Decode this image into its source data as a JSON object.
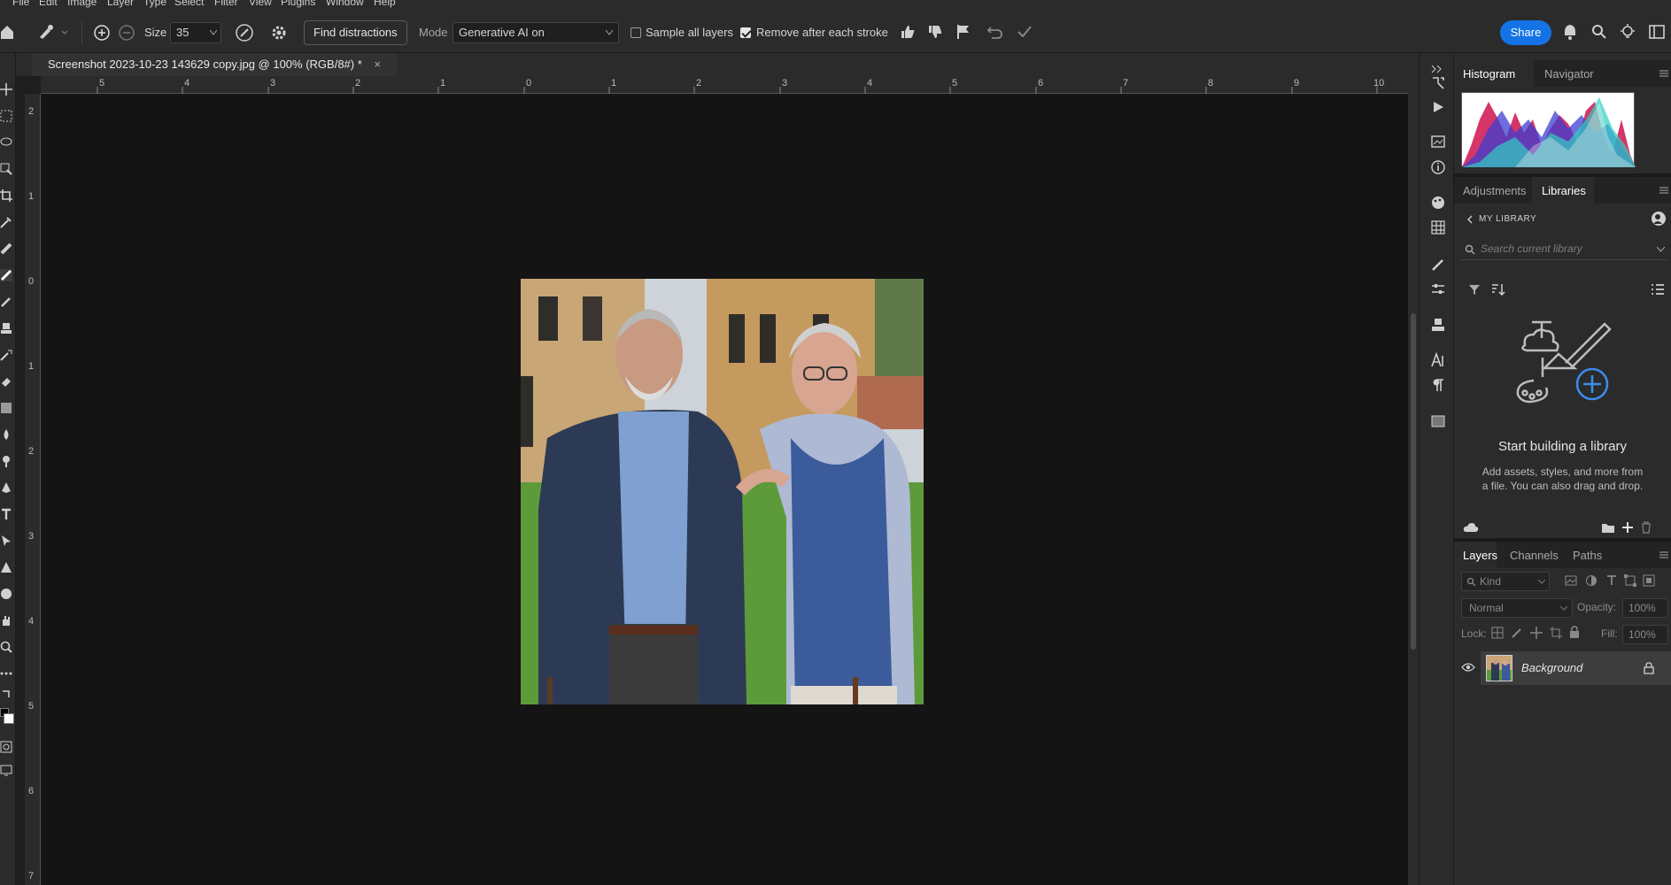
{
  "menu": [
    "File",
    "Edit",
    "Image",
    "Layer",
    "Type",
    "Select",
    "Filter",
    "View",
    "Plugins",
    "Window",
    "Help"
  ],
  "options": {
    "size_label": "Size",
    "size_value": "35",
    "find_distractions": "Find distractions",
    "mode_label": "Mode",
    "mode_value": "Generative AI on",
    "sample_all_layers": "Sample all layers",
    "sample_all_layers_checked": false,
    "remove_after_stroke": "Remove after each stroke",
    "remove_after_stroke_checked": true,
    "share": "Share"
  },
  "document": {
    "tab_title": "Screenshot 2023-10-23 143629 copy.jpg @ 100% (RGB/8#) *"
  },
  "rulers": {
    "h_labels": [
      "5",
      "4",
      "3",
      "2",
      "1",
      "0",
      "1",
      "2",
      "3",
      "4",
      "5",
      "6",
      "7",
      "8",
      "9",
      "10"
    ],
    "v_labels": [
      "2",
      "1",
      "0",
      "1",
      "2",
      "3",
      "4",
      "5",
      "6",
      "7"
    ]
  },
  "histogram_panel": {
    "tabs": [
      "Histogram",
      "Navigator"
    ],
    "active": "Histogram"
  },
  "libraries_panel": {
    "tabs": [
      "Adjustments",
      "Libraries"
    ],
    "active": "Libraries",
    "breadcrumb": "MY LIBRARY",
    "search_placeholder": "Search current library",
    "empty_title": "Start building a library",
    "empty_desc_line1": "Add assets, styles, and more from",
    "empty_desc_line2": "a file. You can also drag and drop."
  },
  "layers_panel": {
    "tabs": [
      "Layers",
      "Channels",
      "Paths"
    ],
    "active": "Layers",
    "kind_label": "Kind",
    "blend_mode": "Normal",
    "opacity_label": "Opacity:",
    "opacity_value": "100%",
    "lock_label": "Lock:",
    "fill_label": "Fill:",
    "fill_value": "100%",
    "layers": [
      {
        "name": "Background",
        "visible": true,
        "locked": true
      }
    ]
  },
  "colors": {
    "accent": "#1473e6",
    "panel": "#2b2b2b",
    "canvas": "#141414"
  }
}
